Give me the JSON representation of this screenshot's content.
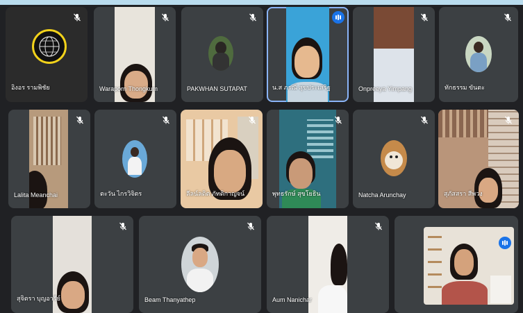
{
  "participants": [
    {
      "name": "อิงอร รามพิชัย",
      "muted": true,
      "speaking": false,
      "avatar": "globe-logo-avatar"
    },
    {
      "name": "Waraporn Thongkum",
      "muted": true,
      "speaking": false,
      "avatar": "camera-video"
    },
    {
      "name": "PAKWHAN SUTAPAT",
      "muted": true,
      "speaking": false,
      "avatar": "photo-avatar"
    },
    {
      "name": "น.ส ภรณี สุขประเสริฐ",
      "muted": false,
      "speaking": true,
      "avatar": "camera-video"
    },
    {
      "name": "Onpreeya Yimpang",
      "muted": true,
      "speaking": false,
      "avatar": "camera-video"
    },
    {
      "name": "ทักธรรม ขันตะ",
      "muted": true,
      "speaking": false,
      "avatar": "photo-avatar"
    },
    {
      "name": "Lalita Meanchai",
      "muted": true,
      "speaking": false,
      "avatar": "camera-video"
    },
    {
      "name": "ตะวัน ไกรวิจิตร",
      "muted": true,
      "speaking": false,
      "avatar": "photo-avatar"
    },
    {
      "name": "ลีลน์ลดิต ภัทติกาญจน์",
      "muted": true,
      "speaking": false,
      "avatar": "camera-video"
    },
    {
      "name": "พุทธรักษ์ สุขโยธิน",
      "muted": true,
      "speaking": false,
      "avatar": "camera-video"
    },
    {
      "name": "Natcha Arunchay",
      "muted": true,
      "speaking": false,
      "avatar": "monkey-photo-avatar"
    },
    {
      "name": "สุภัสสรา สีพวง",
      "muted": true,
      "speaking": false,
      "avatar": "camera-video"
    },
    {
      "name": "สุจิตรา บุญอารีย์",
      "muted": true,
      "speaking": false,
      "avatar": "camera-video"
    },
    {
      "name": "Beam Thanyathep",
      "muted": true,
      "speaking": false,
      "avatar": "photo-avatar"
    },
    {
      "name": "Aum Nanichar",
      "muted": true,
      "speaking": false,
      "avatar": "camera-video"
    },
    {
      "name": "",
      "muted": false,
      "speaking": true,
      "avatar": "self-view-video"
    }
  ]
}
